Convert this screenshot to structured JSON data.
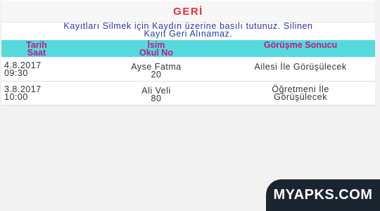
{
  "back_button": {
    "label": "GERİ"
  },
  "info": {
    "line1": "Kayıtları Silmek için Kaydın üzerine basılı tutunuz. Silinen",
    "line2": "Kayıt Geri Alınamaz."
  },
  "table": {
    "headers": {
      "date_line1": "Tarih",
      "date_line2": "Saat",
      "name_line1": "İsim",
      "name_line2": "Okul No",
      "result": "Görüşme Sonucu"
    },
    "rows": [
      {
        "date": "4.8.2017",
        "time": "09:30",
        "name": "Ayse Fatma",
        "school_no": "20",
        "result_line1": "Ailesi İle Görüşülecek",
        "result_line2": ""
      },
      {
        "date": "3.8.2017",
        "time": "10:00",
        "name": "Ali Veli",
        "school_no": "80",
        "result_line1": "Öğretmeni İle",
        "result_line2": "Görüşülecek"
      }
    ]
  },
  "watermark": {
    "text": "MYAPKS.COM"
  },
  "colors": {
    "back_text": "#e0333d",
    "info_text": "#2a36a8",
    "header_bg": "#56d9dc",
    "header_text": "#c2188b",
    "watermark_bg": "#1b2530"
  }
}
